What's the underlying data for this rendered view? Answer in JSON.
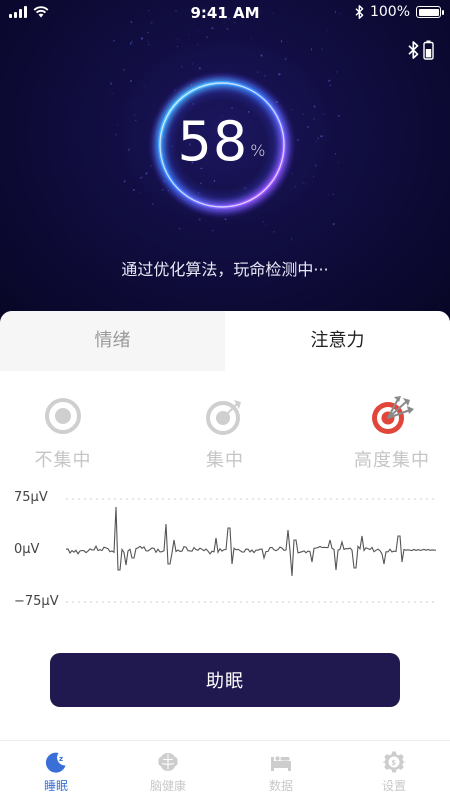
{
  "status_bar": {
    "time": "9:41 AM",
    "battery": "100%",
    "battery_level": 1.0,
    "icons": [
      "signal-icon",
      "wifi-icon",
      "bluetooth-icon",
      "battery-icon"
    ]
  },
  "device": {
    "icons": [
      "bluetooth-icon",
      "battery-icon"
    ]
  },
  "progress": {
    "value": "58",
    "unit": "%",
    "fraction": 0.58
  },
  "status_message": "通过优化算法，玩命检测中···",
  "tabs": [
    {
      "label": "情绪",
      "active": false
    },
    {
      "label": "注意力",
      "active": true
    }
  ],
  "levels": [
    {
      "label": "不集中",
      "icon": "target-icon"
    },
    {
      "label": "集中",
      "icon": "target-arrow-icon"
    },
    {
      "label": "高度集中",
      "icon": "target-bullseye-icon",
      "active": true
    }
  ],
  "waveform": {
    "y_labels": [
      "75μV",
      "0μV",
      "−75μV"
    ]
  },
  "main_button": "助眠",
  "bottom_nav": [
    {
      "label": "睡眠",
      "icon": "moon-sleep-icon",
      "active": true
    },
    {
      "label": "脑健康",
      "icon": "brain-icon",
      "active": false
    },
    {
      "label": "数据",
      "icon": "bed-data-icon",
      "active": false
    },
    {
      "label": "设置",
      "icon": "settings-gear-icon",
      "active": false
    }
  ],
  "colors": {
    "hero_bg": "#0d0a2e",
    "button_bg": "#20194f",
    "accent_active": "#3a6fd8",
    "target_red": "#e0463a"
  }
}
